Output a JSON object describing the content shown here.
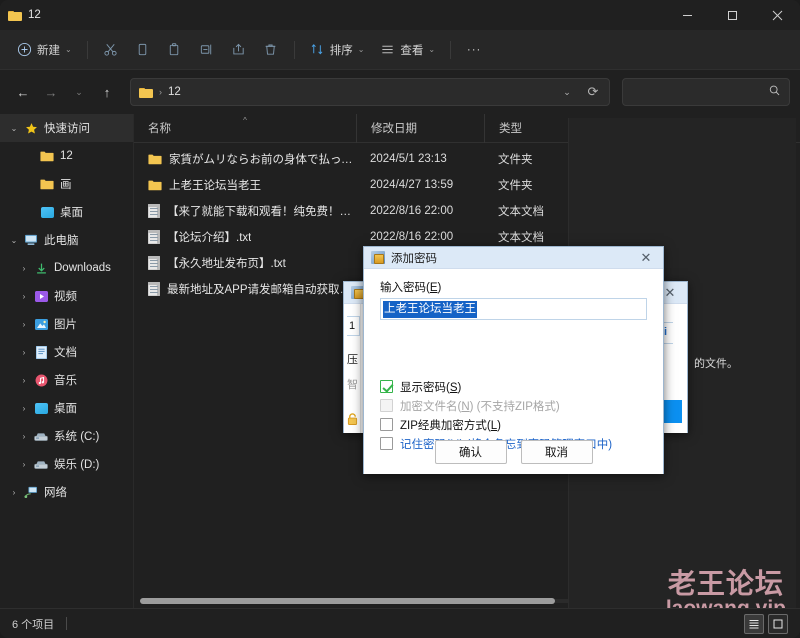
{
  "window": {
    "tab_title": "12",
    "minimize_label": "−",
    "maximize_label": "□",
    "close_label": "✕"
  },
  "toolbar": {
    "new_label": "新建",
    "cut_label": "剪切",
    "copy_label": "复制",
    "paste_label": "粘贴",
    "rename_label": "重命名",
    "share_label": "共享",
    "delete_label": "删除",
    "sort_label": "排序",
    "view_label": "查看",
    "more_label": "···"
  },
  "addressbar": {
    "back_label": "←",
    "forward_label": "→",
    "recent_label": "⌄",
    "up_label": "↑",
    "crumb_sep": "›",
    "path": "12",
    "dropdown_label": "⌄",
    "refresh_label": "⟳",
    "search_placeholder": "",
    "search_value": ""
  },
  "sidebar": {
    "items": [
      {
        "label": "快速访问",
        "icon": "star-icon",
        "indent": 0,
        "expander": "⌄",
        "selected": true,
        "color": "#f0c419"
      },
      {
        "label": "12",
        "icon": "folder-icon",
        "indent": 1,
        "expander": "",
        "selected": false,
        "color": "#f3c550"
      },
      {
        "label": "画",
        "icon": "folder-icon",
        "indent": 1,
        "expander": "",
        "selected": false,
        "color": "#f3c550"
      },
      {
        "label": "桌面",
        "icon": "desktop-icon",
        "indent": 1,
        "expander": "",
        "selected": false,
        "color": "#29a8e0"
      },
      {
        "label": "此电脑",
        "icon": "pc-icon",
        "indent": 0,
        "expander": "⌄",
        "selected": false,
        "color": "#7fb3d5"
      },
      {
        "label": "Downloads",
        "icon": "download-icon",
        "indent": 2,
        "expander": "›",
        "selected": false,
        "color": "#3fbf6f"
      },
      {
        "label": "视频",
        "icon": "video-icon",
        "indent": 2,
        "expander": "›",
        "selected": false,
        "color": "#9b59e8"
      },
      {
        "label": "图片",
        "icon": "picture-icon",
        "indent": 2,
        "expander": "›",
        "selected": false,
        "color": "#2f9fe0"
      },
      {
        "label": "文档",
        "icon": "document-icon",
        "indent": 2,
        "expander": "›",
        "selected": false,
        "color": "#5aa9e6"
      },
      {
        "label": "音乐",
        "icon": "music-icon",
        "indent": 2,
        "expander": "›",
        "selected": false,
        "color": "#e8566f"
      },
      {
        "label": "桌面",
        "icon": "desktop-icon",
        "indent": 2,
        "expander": "›",
        "selected": false,
        "color": "#29a8e0"
      },
      {
        "label": "系统 (C:)",
        "icon": "drive-icon",
        "indent": 2,
        "expander": "›",
        "selected": false,
        "color": "#b7c3cc"
      },
      {
        "label": "娱乐 (D:)",
        "icon": "drive-icon",
        "indent": 2,
        "expander": "›",
        "selected": false,
        "color": "#b7c3cc"
      },
      {
        "label": "网络",
        "icon": "network-icon",
        "indent": 0,
        "expander": "›",
        "selected": false,
        "color": "#5aa9e6"
      }
    ]
  },
  "filelist": {
    "columns": [
      "名称",
      "修改日期",
      "类型"
    ],
    "sort_indicator": "^",
    "rows": [
      {
        "name": "家賃がムリならお前の身体で払ってもら...",
        "date": "2024/5/1 23:13",
        "type": "文件夹",
        "icon": "folder-icon"
      },
      {
        "name": "上老王论坛当老王",
        "date": "2024/4/27 13:59",
        "type": "文件夹",
        "icon": "folder-icon"
      },
      {
        "name": "【来了就能下载和观看！纯免费！】.txt",
        "date": "2022/8/16 22:00",
        "type": "文本文档",
        "icon": "text-file-icon"
      },
      {
        "name": "【论坛介绍】.txt",
        "date": "2022/8/16 22:00",
        "type": "文本文档",
        "icon": "text-file-icon"
      },
      {
        "name": "【永久地址发布页】.txt",
        "date": "",
        "type": "",
        "icon": "text-file-icon"
      },
      {
        "name": "最新地址及APP请发邮箱自动获取！！！",
        "date": "",
        "type": "",
        "icon": "text-file-icon"
      }
    ]
  },
  "statusbar": {
    "item_count": "6 个项目",
    "view_details_label": "详细信息",
    "view_large_label": "大图标"
  },
  "watermark": {
    "line1": "老王论坛",
    "line2": "laowang.vip",
    "color": "#c99aa4"
  },
  "back_dialog": {
    "close_label": "✕",
    "fragment_input": "1",
    "fragment_compress": "压",
    "fragment_gray": "智",
    "fragment_right": "i",
    "text_right": "的文件。"
  },
  "password_dialog": {
    "title": "添加密码",
    "close_label": "✕",
    "input_label_pre": "输入密码(",
    "input_label_key": "E",
    "input_label_post": ")",
    "password_value": "上老王论坛当老王",
    "checkboxes": [
      {
        "pre": "显示密码(",
        "key": "S",
        "post": ")",
        "state": "checked",
        "style": "normal"
      },
      {
        "pre": "加密文件名(",
        "key": "N",
        "post": ") (不支持ZIP格式)",
        "state": "disabled",
        "style": "dim"
      },
      {
        "pre": "ZIP经典加密方式(",
        "key": "L",
        "post": ")",
        "state": "unchecked",
        "style": "normal"
      },
      {
        "pre": "记住密码(",
        "key": "M",
        "post": ") (将会备忘到密码管理窗口中)",
        "state": "unchecked",
        "style": "link"
      }
    ],
    "ok_label": "确认",
    "cancel_label": "取消"
  }
}
